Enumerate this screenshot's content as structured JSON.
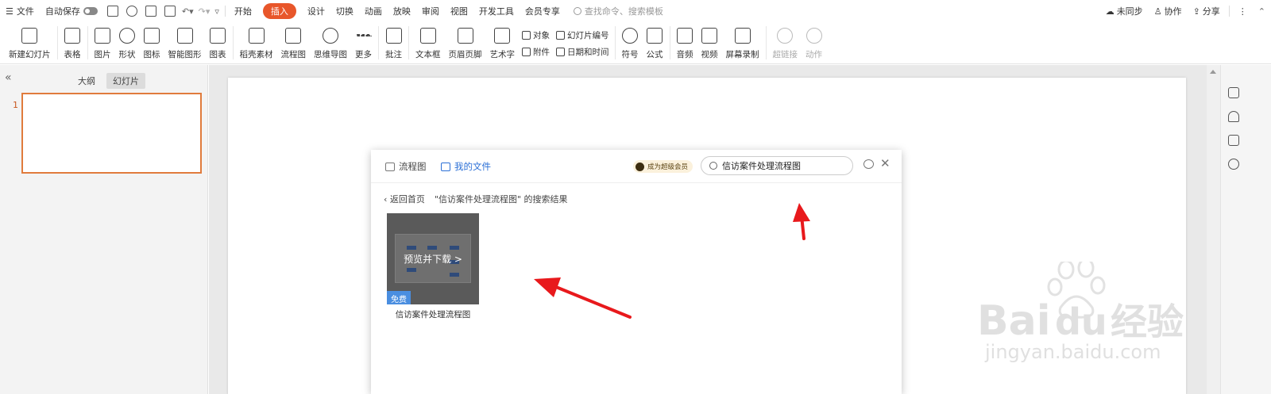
{
  "menubar": {
    "file": "文件",
    "autosave": "自动保存",
    "tabs": [
      "开始",
      "插入",
      "设计",
      "切换",
      "动画",
      "放映",
      "审阅",
      "视图",
      "开发工具",
      "会员专享"
    ],
    "active_tab": "插入",
    "search_placeholder": "查找命令、搜索模板",
    "right": {
      "sync": "未同步",
      "collab": "协作",
      "share": "分享"
    }
  },
  "ribbon": {
    "new_slide": "新建幻灯片",
    "table": "表格",
    "picture": "图片",
    "shape": "形状",
    "icon": "图标",
    "smart_graphic": "智能图形",
    "chart": "图表",
    "material": "稻壳素材",
    "flowchart": "流程图",
    "mindmap": "思维导图",
    "more": "更多",
    "comment": "批注",
    "textbox": "文本框",
    "header_footer": "页眉页脚",
    "wordart": "艺术字",
    "object": "对象",
    "attachment": "附件",
    "slide_number": "幻灯片编号",
    "date_time": "日期和时间",
    "symbol": "符号",
    "formula": "公式",
    "audio": "音频",
    "video": "视频",
    "screen_record": "屏幕录制",
    "hyperlink": "超链接",
    "action": "动作"
  },
  "left_panel": {
    "tab_outline": "大纲",
    "tab_slides": "幻灯片",
    "slide_number": "1"
  },
  "dialog": {
    "tab_flowchart": "流程图",
    "tab_my_files": "我的文件",
    "vip_label": "成为超级会员",
    "search_value": "信访案件处理流程图",
    "back_label": "返回首页",
    "result_caption": "\"信访案件处理流程图\" 的搜索结果",
    "card": {
      "overlay": "预览并下载 >",
      "badge": "免费",
      "title": "信访案件处理流程图"
    }
  },
  "watermark": {
    "brand": "Bai",
    "du": "du",
    "cn": "经验",
    "url": "jingyan.baidu.com"
  },
  "colors": {
    "accent": "#e8562a",
    "arrow": "#e8191c",
    "link": "#2b6fd6",
    "badge": "#4a8ee0"
  }
}
